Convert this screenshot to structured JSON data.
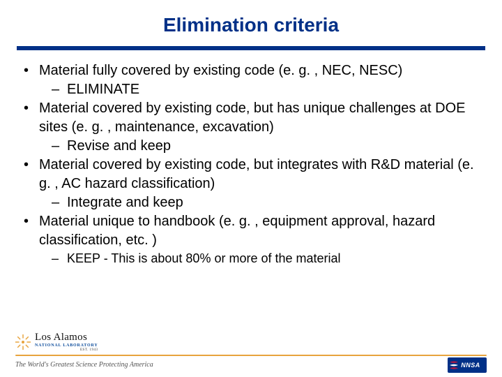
{
  "title": "Elimination criteria",
  "bullets": [
    {
      "text": "Material fully covered by existing code (e. g. , NEC, NESC)",
      "sub": "ELIMINATE"
    },
    {
      "text": "Material covered by existing code, but has unique challenges at DOE sites (e. g. , maintenance, excavation)",
      "sub": "Revise and keep"
    },
    {
      "text": "Material covered by existing code, but integrates with R&D material (e. g. , AC hazard classification)",
      "sub": "Integrate and keep"
    },
    {
      "text": "Material unique to handbook (e. g. , equipment approval, hazard classification, etc. )",
      "sub": "KEEP - This is about 80% or more of the material",
      "subSmaller": true
    }
  ],
  "footer": {
    "lanl_name": "Los Alamos",
    "lanl_sub": "NATIONAL LABORATORY",
    "lanl_est": "EST. 1943",
    "tagline": "The World's Greatest Science Protecting America",
    "nnsa": "NNSA"
  }
}
